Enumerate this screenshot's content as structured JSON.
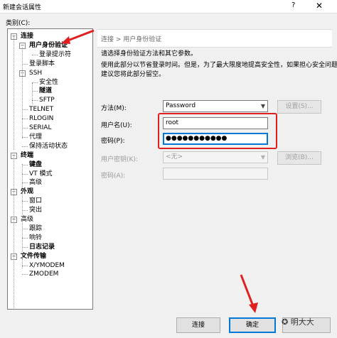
{
  "window": {
    "title": "新建会话属性",
    "help": "?",
    "close": "✕"
  },
  "category_label": "类别(C):",
  "tree": [
    {
      "label": "连接",
      "bold": true,
      "expander": "−"
    },
    {
      "label": "用户身份验证",
      "bold": true,
      "expander": "−"
    },
    {
      "label": "登录提示符",
      "bold": false
    },
    {
      "label": "登录脚本",
      "bold": false
    },
    {
      "label": "SSH",
      "bold": false,
      "expander": "−"
    },
    {
      "label": "安全性",
      "bold": false
    },
    {
      "label": "隧道",
      "bold": true
    },
    {
      "label": "SFTP",
      "bold": false
    },
    {
      "label": "TELNET",
      "bold": false
    },
    {
      "label": "RLOGIN",
      "bold": false
    },
    {
      "label": "SERIAL",
      "bold": false
    },
    {
      "label": "代理",
      "bold": false
    },
    {
      "label": "保持活动状态",
      "bold": false
    },
    {
      "label": "终端",
      "bold": true,
      "expander": "−"
    },
    {
      "label": "键盘",
      "bold": true
    },
    {
      "label": "VT 模式",
      "bold": false
    },
    {
      "label": "高级",
      "bold": false
    },
    {
      "label": "外观",
      "bold": true,
      "expander": "−"
    },
    {
      "label": "窗口",
      "bold": false
    },
    {
      "label": "突出",
      "bold": false
    },
    {
      "label": "高级",
      "bold": false,
      "expander": "−"
    },
    {
      "label": "跟踪",
      "bold": false
    },
    {
      "label": "响铃",
      "bold": false
    },
    {
      "label": "日志记录",
      "bold": true
    },
    {
      "label": "文件传输",
      "bold": true,
      "expander": "−"
    },
    {
      "label": "X/YMODEM",
      "bold": false
    },
    {
      "label": "ZMODEM",
      "bold": false
    }
  ],
  "breadcrumb": "连接 > 用户身份验证",
  "description": {
    "line1": "请选择身份验证方法和其它参数。",
    "line2": "使用此部分以节省登录时间。但是，为了最大限度地提高安全性，如果担心安全问题，",
    "line3": "建议您将此部分留空。"
  },
  "form": {
    "method_label": "方法(M):",
    "method_value": "Password",
    "settings_button": "设置(S)...",
    "username_label": "用户名(U):",
    "username_value": "root",
    "password_label": "密码(P):",
    "password_value": "●●●●●●●●●●●",
    "user_key_label": "用户密钥(K):",
    "user_key_value": "<无>",
    "browse_button": "浏览(B)...",
    "passphrase_label": "密码(A):"
  },
  "buttons": {
    "connect": "连接",
    "ok": "确定",
    "cancel": "取消"
  },
  "watermark": "明大大",
  "colors": {
    "annotation_red": "#e02020",
    "focus_blue": "#0078d7"
  }
}
